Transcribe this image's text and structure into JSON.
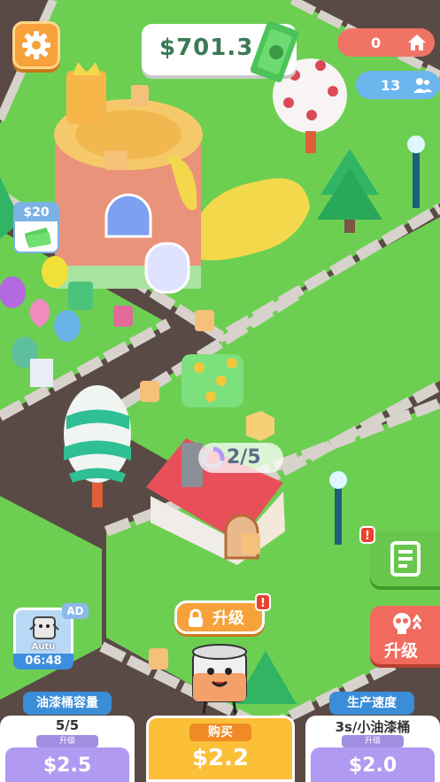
{
  "hud": {
    "money": "$701.3",
    "stat_red_value": "0",
    "stat_blue_value": "13",
    "price_tag": "$20",
    "progress": "2/5",
    "upgrade_label": "升级",
    "upgrade_badge": "!",
    "task_badge": "!",
    "right_upgrade_label": "升级",
    "ad_tag": "AD",
    "ad_timer": "06:48",
    "ad_name": "Autu"
  },
  "cards": [
    {
      "header": "油漆桶容量",
      "count": "5/5",
      "mini": "升级",
      "price": "$2.5"
    },
    {
      "header": "",
      "count": "",
      "mini": "购买",
      "price": "$2.2"
    },
    {
      "header": "生产速度",
      "count": "3s/小油漆桶",
      "mini": "升级",
      "price": "$2.0"
    }
  ],
  "colors": {
    "grass": "#6dcf52",
    "road": "#5a4a45",
    "accent_orange": "#f6a13a",
    "money_green": "#3a7a55",
    "card_purple": "#b19af1",
    "buy_yellow": "#fbbf38"
  },
  "icons": [
    "gear-icon",
    "dollar-bill-icon",
    "house-icon",
    "people-icon",
    "checklist-icon",
    "skull-icon",
    "lock-icon"
  ]
}
